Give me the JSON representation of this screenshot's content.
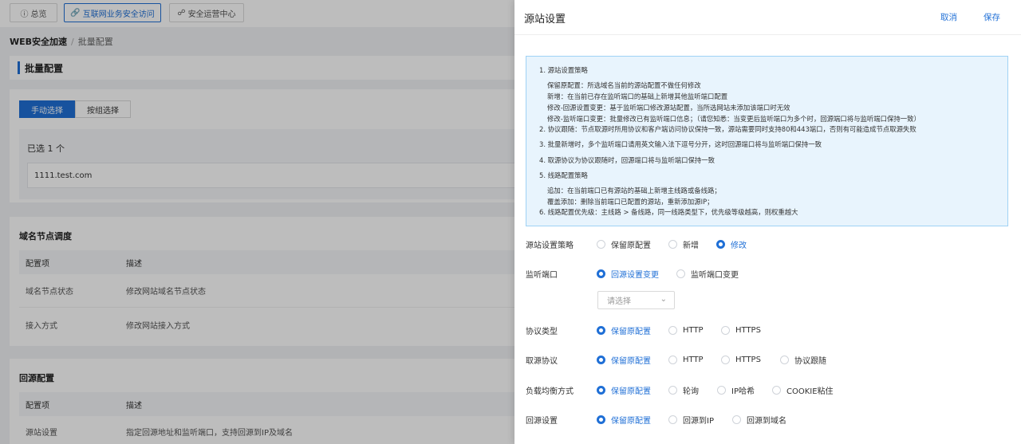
{
  "topnav": {
    "tabs": [
      {
        "icon": "info-circle-icon",
        "label": "总览"
      },
      {
        "icon": "link-icon",
        "label": "互联网业务安全访问"
      },
      {
        "icon": "shield-icon",
        "label": "安全运营中心"
      }
    ]
  },
  "breadcrumb": {
    "root": "WEB安全加速",
    "separator": "/",
    "current": "批量配置"
  },
  "batch": {
    "title": "批量配置",
    "modes": [
      "手动选择",
      "按组选择"
    ],
    "selected_count": "已选 1 个",
    "selected_domain": "1111.test.com"
  },
  "domain_schedule": {
    "title": "域名节点调度",
    "headers": [
      "配置项",
      "描述"
    ],
    "rows": [
      [
        "域名节点状态",
        "修改网站域名节点状态"
      ],
      [
        "接入方式",
        "修改网站接入方式"
      ]
    ]
  },
  "origin_config": {
    "title": "回源配置",
    "headers": [
      "配置项",
      "描述"
    ],
    "rows": [
      [
        "源站设置",
        "指定回源地址和监听端口，支持回源到IP及域名"
      ]
    ]
  },
  "drawer": {
    "title": "源站设置",
    "cancel": "取消",
    "save": "保存",
    "info_lines": [
      "1. 源站设置策略",
      "保留原配置：所选域名当前的源站配置不做任何修改",
      "新增：在当前已存在监听端口的基础上新增其他监听端口配置",
      "修改-回源设置变更：基于监听端口修改源站配置，当所选网站未添加该端口时无效",
      "修改-监听端口变更：批量修改已有监听端口信息；（请您知悉：当变更后监听端口为多个时，回源端口将与监听端口保持一致）",
      "2. 协议跟随：节点取源时所用协议和客户端访问协议保持一致，源站需要同时支持80和443端口，否则有可能造成节点取源失败",
      "3. 批量新增时，多个监听端口请用英文输入法下逗号分开，这时回源端口将与监听端口保持一致",
      "4. 取源协议为协议跟随时，回源端口将与监听端口保持一致",
      "5. 线路配置策略",
      "追加：在当前端口已有源站的基础上新增主线路或备线路；",
      "覆盖添加：删除当前端口已配置的源站，重新添加源IP；",
      "6. 线路配置优先级：主线路 > 备线路，同一线路类型下，优先级等级越高，则权重越大"
    ],
    "fields": {
      "strategy": {
        "label": "源站设置策略",
        "options": [
          "保留原配置",
          "新增",
          "修改"
        ],
        "selected": "修改"
      },
      "port": {
        "label": "监听端口",
        "options": [
          "回源设置变更",
          "监听端口变更"
        ],
        "selected": "回源设置变更",
        "select_placeholder": "请选择"
      },
      "protocol": {
        "label": "协议类型",
        "options": [
          "保留原配置",
          "HTTP",
          "HTTPS"
        ],
        "selected": "保留原配置"
      },
      "fetch_protocol": {
        "label": "取源协议",
        "options": [
          "保留原配置",
          "HTTP",
          "HTTPS",
          "协议跟随"
        ],
        "selected": "保留原配置"
      },
      "lb": {
        "label": "负载均衡方式",
        "options": [
          "保留原配置",
          "轮询",
          "IP哈希",
          "COOKIE粘住"
        ],
        "selected": "保留原配置"
      },
      "back_origin": {
        "label": "回源设置",
        "options": [
          "保留原配置",
          "回源到IP",
          "回源到域名"
        ],
        "selected": "保留原配置"
      }
    }
  },
  "colors": {
    "accent": "#1f6fd6",
    "info_bg": "#e8f4fd",
    "info_border": "#9fd2f5"
  }
}
